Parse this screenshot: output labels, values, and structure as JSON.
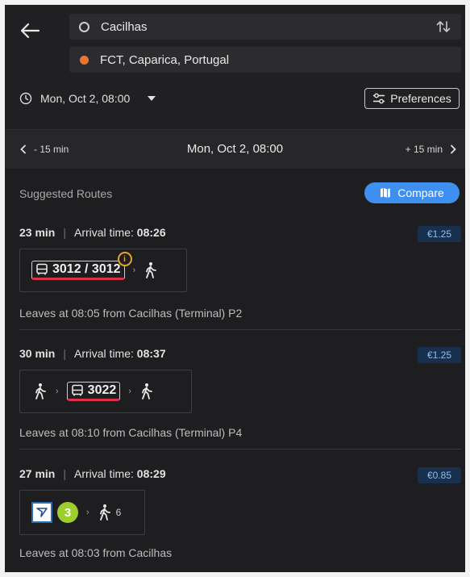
{
  "header": {
    "from": "Cacilhas",
    "to": "FCT, Caparica, Portugal",
    "datetime": "Mon, Oct 2, 08:00",
    "preferences_label": "Preferences"
  },
  "shift": {
    "prev_label": "- 15 min",
    "center_label": "Mon, Oct 2, 08:00",
    "next_label": "+ 15 min"
  },
  "routes_section": {
    "title": "Suggested Routes",
    "compare_label": "Compare"
  },
  "arrival_label": "Arrival time:",
  "routes": [
    {
      "duration": "23 min",
      "arrival": "08:26",
      "price": "€1.25",
      "line": "3012 / 3012",
      "warning": "i",
      "leaves": "Leaves at 08:05 from Cacilhas (Terminal) P2"
    },
    {
      "duration": "30 min",
      "arrival": "08:37",
      "price": "€1.25",
      "line": "3022",
      "leaves": "Leaves at 08:10 from Cacilhas (Terminal) P4"
    },
    {
      "duration": "27 min",
      "arrival": "08:29",
      "price": "€0.85",
      "line_badge": "3",
      "walk_minutes": "6",
      "leaves": "Leaves at 08:03 from Cacilhas"
    }
  ],
  "colors": {
    "accent": "#3e8ff0",
    "origin_dot": "#f0732d",
    "bus_underline": "#d8334a",
    "line_badge": "#9ccf2b",
    "price_text": "#8fbef0"
  }
}
